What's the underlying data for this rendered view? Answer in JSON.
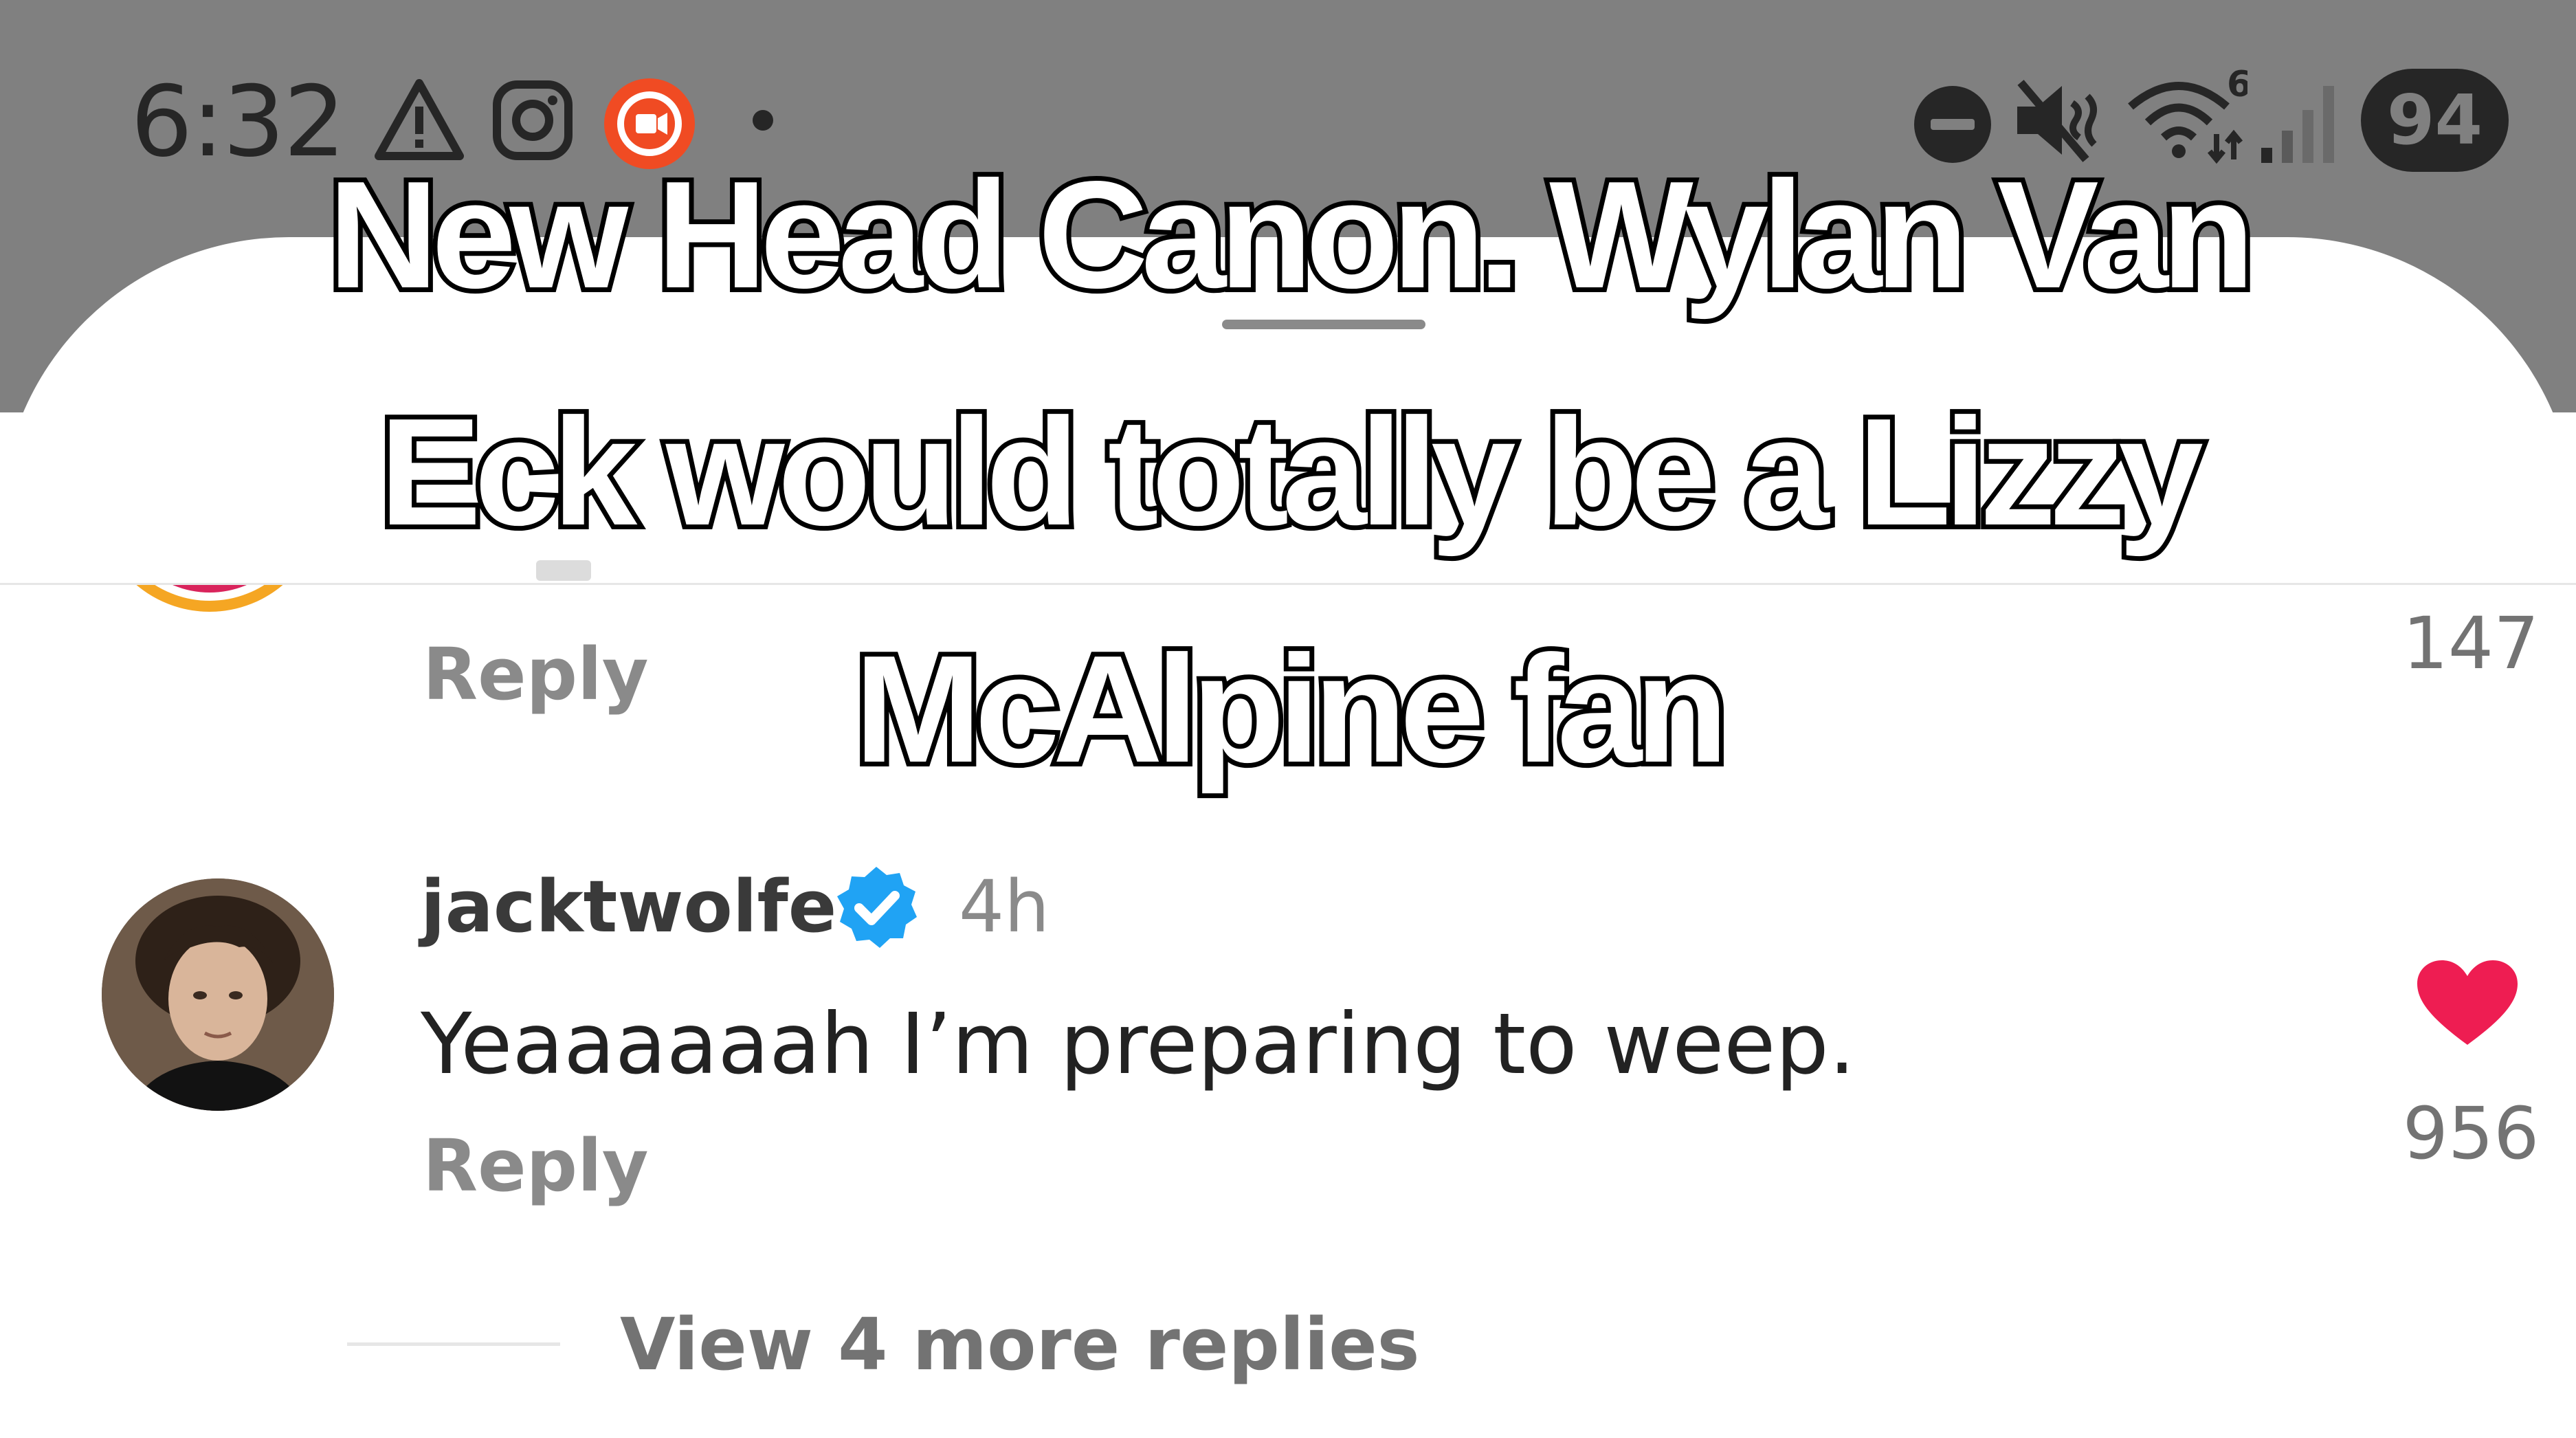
{
  "status_bar": {
    "time": "6:32",
    "battery": "94",
    "wifi_badge": "6",
    "icons": [
      "warning-icon",
      "instagram-icon",
      "screen-recorder-icon",
      "notification-dot-icon",
      "do-not-disturb-icon",
      "vibrate-mute-icon",
      "wifi-icon",
      "signal-icon",
      "battery-icon"
    ]
  },
  "overlay_caption": {
    "line1": "New Head Canon. Wylan Van",
    "line2": "Eck would totally be a Lizzy",
    "line3": "McAlpine fan"
  },
  "previous_comment": {
    "reply_label": "Reply",
    "like_count": "147"
  },
  "comment": {
    "username": "jacktwolfe",
    "verified": true,
    "time_ago": "4h",
    "text": "Yeaaaaaah I’m preparing to weep.",
    "reply_label": "Reply",
    "like_count": "956",
    "liked": true
  },
  "view_more_replies": "View 4 more replies",
  "colors": {
    "status_bar_bg": "#808080",
    "sheet_bg": "#ffffff",
    "heart": "#ee1d52",
    "verified": "#20a3f4",
    "instagram_ring": "#f5a623",
    "recorder": "#f04b23"
  }
}
